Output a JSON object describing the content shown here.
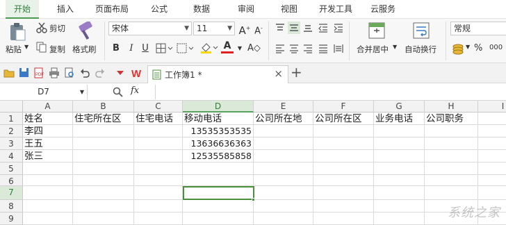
{
  "menu_tabs": [
    {
      "label": "开始",
      "active": true
    },
    {
      "label": "插入",
      "active": false
    },
    {
      "label": "页面布局",
      "active": false
    },
    {
      "label": "公式",
      "active": false
    },
    {
      "label": "数据",
      "active": false
    },
    {
      "label": "审阅",
      "active": false
    },
    {
      "label": "视图",
      "active": false
    },
    {
      "label": "开发工具",
      "active": false
    },
    {
      "label": "云服务",
      "active": false
    }
  ],
  "ribbon": {
    "paste": "粘贴",
    "cut": "剪切",
    "copy": "复制",
    "format_painter": "格式刷",
    "font_name": "宋体",
    "font_size": "11",
    "merge_center": "合并居中",
    "wrap_text": "自动换行",
    "number_format": "常规",
    "percent": "%",
    "thousands": "000"
  },
  "doc_tab": {
    "title": "工作簿1 *",
    "close": "×",
    "new": "+"
  },
  "formula_bar": {
    "name_box": "D7",
    "fx": "fx",
    "value": ""
  },
  "columns": [
    "A",
    "B",
    "C",
    "D",
    "E",
    "F",
    "G",
    "H",
    "I"
  ],
  "selected_column": "D",
  "rows": [
    "1",
    "2",
    "3",
    "4",
    "5",
    "6",
    "7",
    "8",
    "9"
  ],
  "selected_row": "7",
  "cells": {
    "A1": "姓名",
    "B1": "住宅所在区",
    "C1": "住宅电话",
    "D1": "移动电话",
    "E1": "公司所在地",
    "F1": "公司所在区",
    "G1": "业务电话",
    "H1": "公司职务",
    "A2": "李四",
    "D2": "13535353535",
    "A3": "王五",
    "D3": "13636636363",
    "A4": "张三",
    "D4": "12535585858"
  },
  "colors": {
    "accent": "#4a8f3c",
    "active_tab_bg": "#e9f2e9"
  }
}
